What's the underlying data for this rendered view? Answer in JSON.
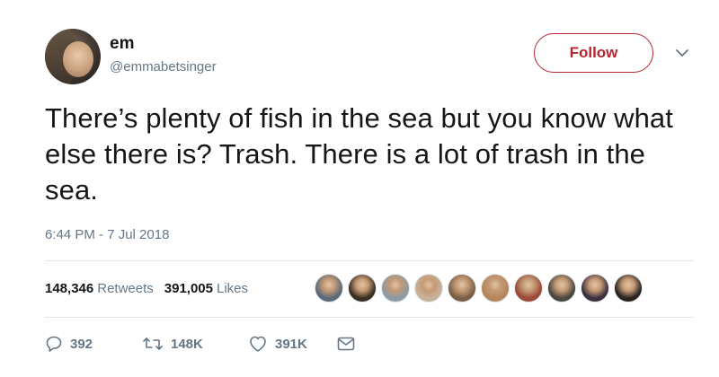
{
  "user": {
    "name": "em",
    "handle": "@emmabetsinger",
    "avatar_icon": "profile-photo"
  },
  "header": {
    "follow_label": "Follow",
    "accent_color": "#b5252f",
    "menu_icon": "chevron-down-icon"
  },
  "tweet": {
    "text": "There’s plenty of fish in the sea but you know what else there is? Trash. There is a lot of trash in the sea.",
    "timestamp": "6:44 PM - 7 Jul 2018"
  },
  "stats": {
    "retweets_count": "148,346",
    "retweets_label": "Retweets",
    "likes_count": "391,005",
    "likes_label": "Likes",
    "liker_avatars": [
      {
        "color": "#5a6a78"
      },
      {
        "color": "#3b2e22"
      },
      {
        "color": "#8e9aa4"
      },
      {
        "color": "#c9b29a"
      },
      {
        "color": "#7a5f46"
      },
      {
        "color": "#b5865c"
      },
      {
        "color": "#9a4a36"
      },
      {
        "color": "#4a4640"
      },
      {
        "color": "#3c3040"
      },
      {
        "color": "#2a2320"
      }
    ]
  },
  "actions": {
    "reply_count": "392",
    "retweet_count": "148K",
    "like_count": "391K",
    "icons": [
      "reply-icon",
      "retweet-icon",
      "like-icon",
      "message-icon"
    ]
  }
}
